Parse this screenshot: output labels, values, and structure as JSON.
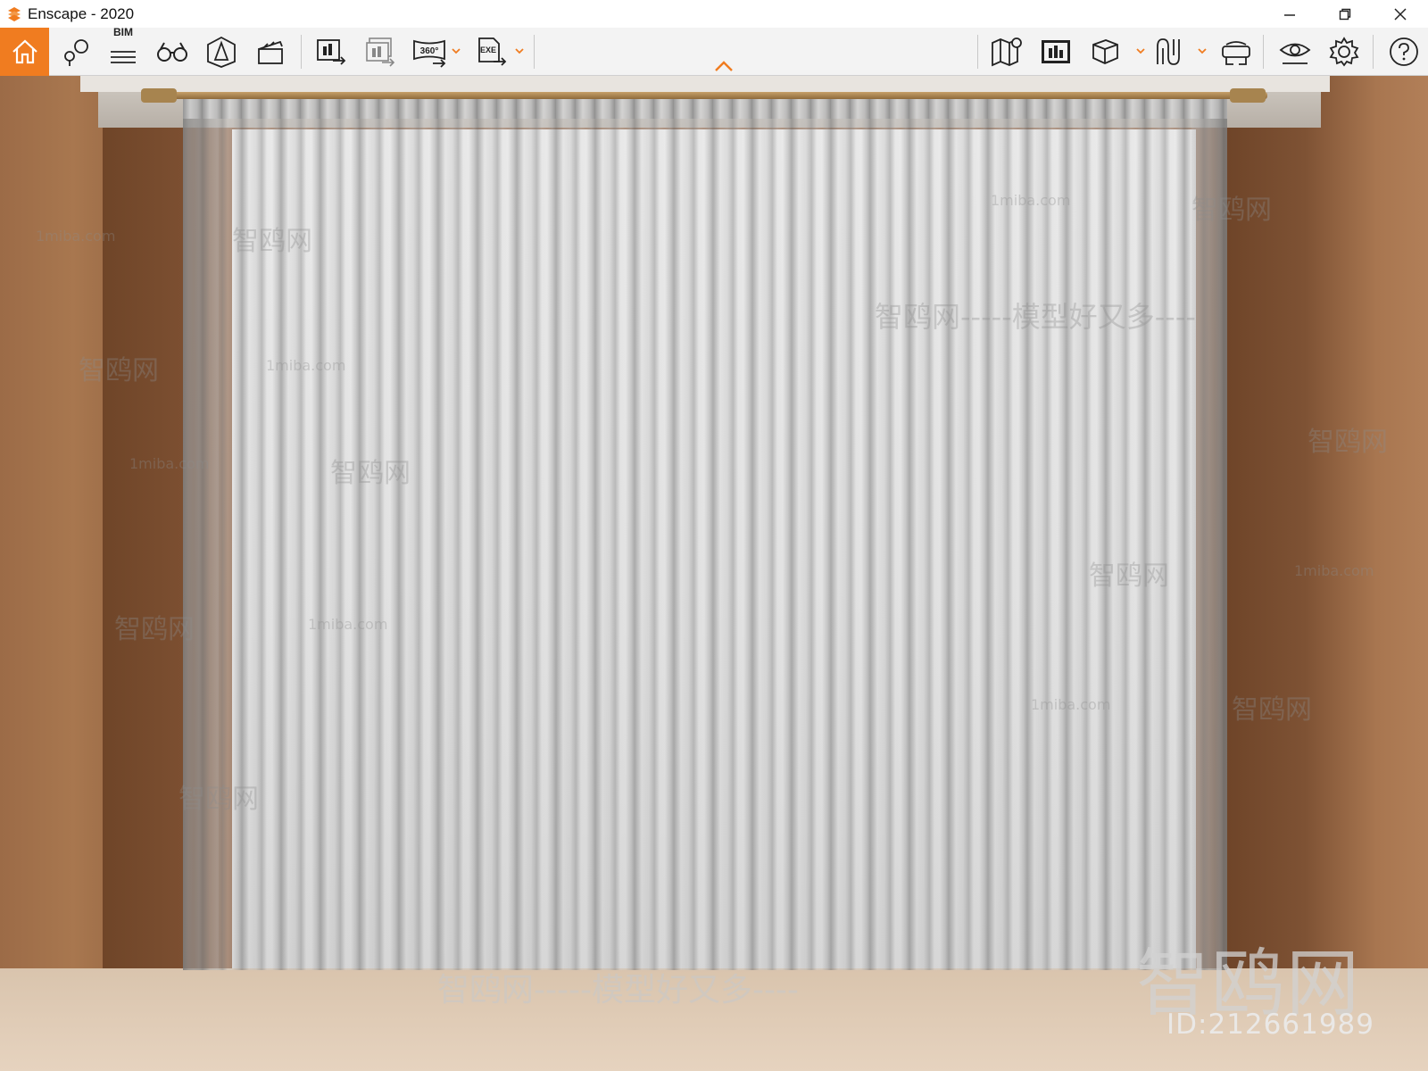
{
  "window": {
    "app_title": "Enscape - 2020",
    "controls": [
      "minimize",
      "restore",
      "close"
    ]
  },
  "toolbar": {
    "home": {
      "icon": "home-icon",
      "active_color": "#f07c20"
    },
    "bim_label": "BIM",
    "left_buttons": [
      "home-icon",
      "views-icon",
      "bim-icon",
      "binoculars-icon",
      "cone-icon",
      "clapper-icon",
      "screenshot-export-icon",
      "batch-export-icon",
      "panorama-360-icon",
      "exe-export-icon"
    ],
    "panorama_label": "360°",
    "exe_label": "EXE",
    "right_buttons": [
      "map-icon",
      "image-export-icon",
      "cube-icon",
      "spline-icon",
      "vr-headset-icon",
      "eye-icon",
      "gear-icon",
      "help-icon"
    ],
    "collapse_icon": "chevron-up-icon"
  },
  "viewport": {
    "watermarks": {
      "brand": "智鸥网",
      "id": "ID:212661989",
      "site": "1miba.com",
      "slogan": "智鸥网-----模型好又多----"
    }
  }
}
